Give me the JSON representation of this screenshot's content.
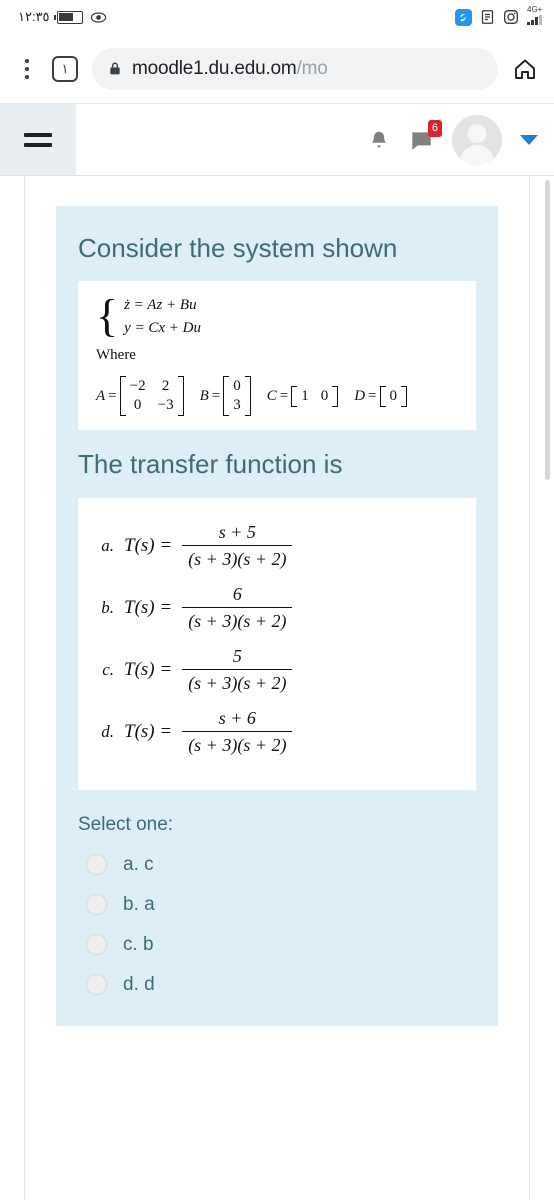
{
  "status_bar": {
    "time": "١٢:٣٥",
    "battery_icon": "battery-icon",
    "eye_icon": "eye-icon",
    "app_icon": "blue-app-icon",
    "doc_icon": "document-icon",
    "instagram_icon": "instagram-icon",
    "network_label": "4G+",
    "signal_icon": "signal-bars-icon"
  },
  "browser": {
    "menu_icon": "kebab-menu-icon",
    "tab_count": "١",
    "lock_icon": "lock-icon",
    "url_visible": "moodle1.du.edu.om",
    "url_path": "/mo",
    "home_icon": "home-icon"
  },
  "navbar": {
    "menu_icon": "hamburger-menu-icon",
    "bell_icon": "notifications-bell-icon",
    "message_icon": "messages-icon",
    "message_badge": "6",
    "avatar_icon": "user-avatar",
    "caret_icon": "chevron-down-icon"
  },
  "question": {
    "title": "Consider the system shown",
    "system": {
      "eq1": "ż = Az + Bu",
      "eq2": "y = Cx + Du",
      "where_label": "Where",
      "matrices": {
        "A_label": "A",
        "A": [
          [
            "−2",
            "2"
          ],
          [
            "0",
            "−3"
          ]
        ],
        "B_label": "B",
        "B": [
          [
            "0"
          ],
          [
            "3"
          ]
        ],
        "C_label": "C",
        "C": [
          "1",
          "0"
        ],
        "D_label": "D",
        "D": [
          "0"
        ]
      }
    },
    "subtitle": "The transfer function is",
    "options_math": [
      {
        "label": "a.",
        "lhs": "T(s) =",
        "numerator": "s + 5",
        "denominator": "(s + 3)(s + 2)"
      },
      {
        "label": "b.",
        "lhs": "T(s) =",
        "numerator": "6",
        "denominator": "(s + 3)(s + 2)"
      },
      {
        "label": "c.",
        "lhs": "T(s) =",
        "numerator": "5",
        "denominator": "(s + 3)(s + 2)"
      },
      {
        "label": "d.",
        "lhs": "T(s) =",
        "numerator": "s + 6",
        "denominator": "(s + 3)(s + 2)"
      }
    ],
    "select_one": "Select one:",
    "answers": [
      {
        "label": "a. c",
        "selected": false
      },
      {
        "label": "b. a",
        "selected": false
      },
      {
        "label": "c. b",
        "selected": false
      },
      {
        "label": "d. d",
        "selected": false
      }
    ]
  },
  "colors": {
    "card_bg": "#ddeef6",
    "heading": "#3f6b75",
    "badge": "#d9232d",
    "caret": "#1e7fd4"
  }
}
